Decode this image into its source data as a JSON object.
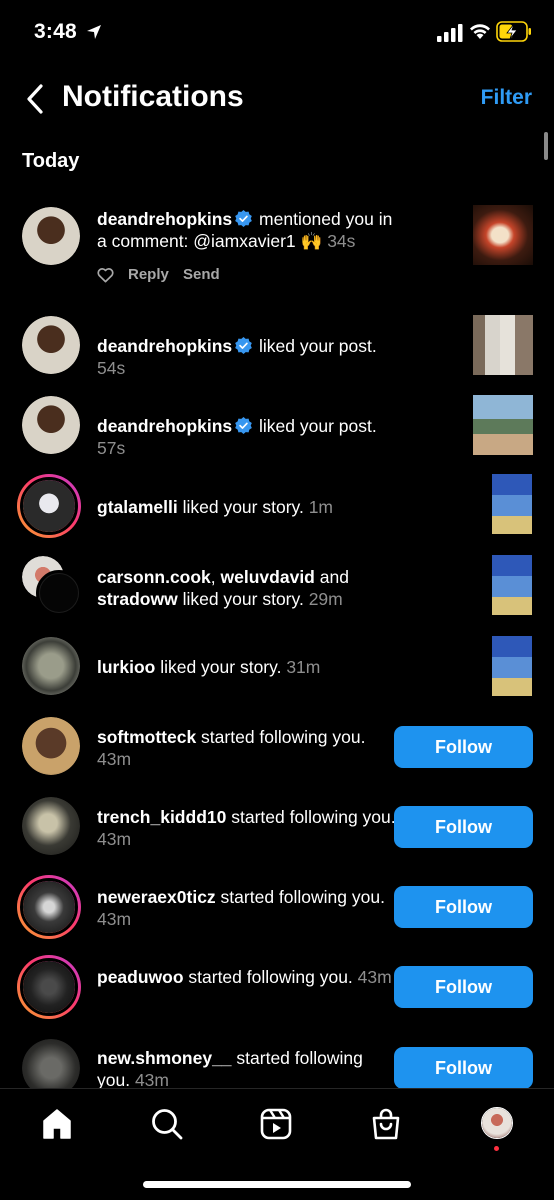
{
  "status_bar": {
    "time": "3:48"
  },
  "header": {
    "title": "Notifications",
    "filter_label": "Filter"
  },
  "sections": {
    "today": "Today"
  },
  "notifications": [
    {
      "user": "deandrehopkins",
      "verified": true,
      "text": " mentioned you in a comment: @iamxavier1 🙌 ",
      "time": "34s",
      "actions": {
        "reply": "Reply",
        "send": "Send"
      }
    },
    {
      "user": "deandrehopkins",
      "verified": true,
      "text": " liked your post. ",
      "time": "54s"
    },
    {
      "user": "deandrehopkins",
      "verified": true,
      "text": " liked your post. ",
      "time": "57s"
    },
    {
      "user": "gtalamelli",
      "text": " liked your story. ",
      "time": "1m"
    },
    {
      "user": "carsonn.cook",
      "sep1": ", ",
      "user2": "weluvdavid",
      "sep2": " and ",
      "user3": "stradoww",
      "text": " liked your story. ",
      "time": "29m"
    },
    {
      "user": "lurkioo",
      "text": " liked your story. ",
      "time": "31m"
    },
    {
      "user": "softmotteck",
      "text": " started following you. ",
      "time": "43m",
      "button": "Follow"
    },
    {
      "user": "trench_kiddd10",
      "text": " started following you. ",
      "time": "43m",
      "button": "Follow"
    },
    {
      "user": "neweraex0ticz",
      "text": " started following you. ",
      "time": "43m",
      "button": "Follow"
    },
    {
      "user": "peaduwoo",
      "text": " started following you. ",
      "time": "43m",
      "button": "Follow"
    },
    {
      "user": "new.shmoney__",
      "text": " started following you. ",
      "time": "43m",
      "button": "Follow"
    }
  ],
  "colors": {
    "accent": "#1e93ef",
    "link": "#2f9bf5",
    "muted": "#8e8e8e",
    "verified": "#3897f0",
    "background": "#000000"
  },
  "tabs": [
    "home-icon",
    "search-icon",
    "reels-icon",
    "shop-icon",
    "profile-avatar"
  ]
}
